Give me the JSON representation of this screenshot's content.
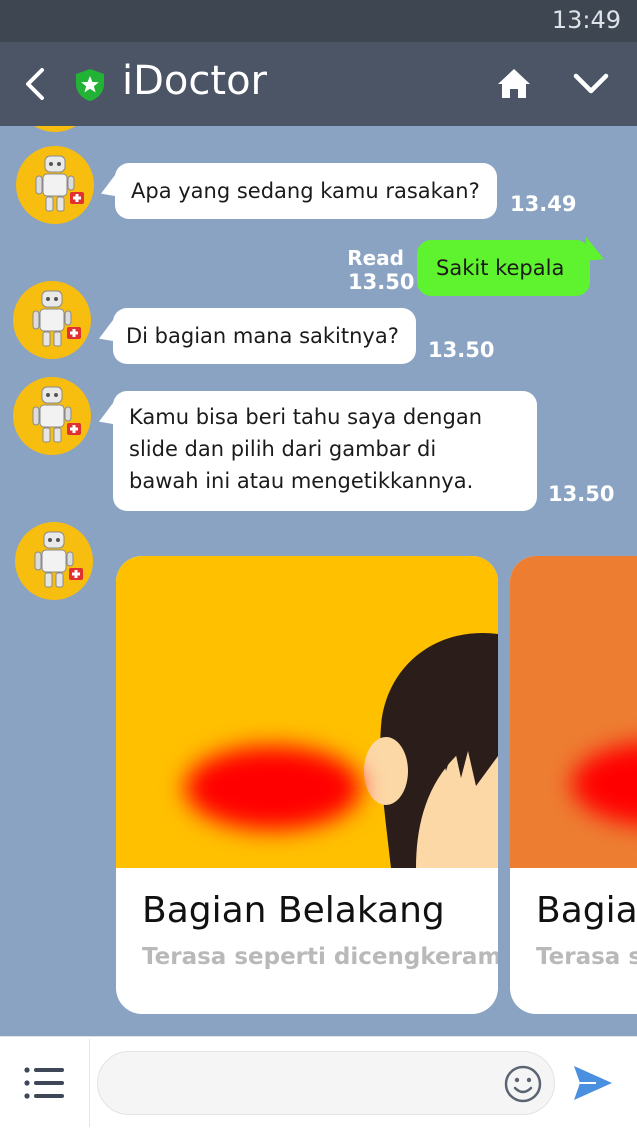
{
  "status_bar": {
    "time": "13:49"
  },
  "header": {
    "title": "iDoctor",
    "back_icon": "chevron-left-icon",
    "home_icon": "home-icon",
    "menu_icon": "chevron-down-icon",
    "colors": {
      "bar": "#4b5566",
      "shield": "#22b336"
    }
  },
  "chat": {
    "background": "#8aa3c3",
    "messages": [
      {
        "sender": "bot",
        "text": "Apa yang sedang kamu rasakan?",
        "time": "13.49"
      },
      {
        "sender": "user",
        "text": "Sakit kepala",
        "time": "13.50",
        "status": "Read"
      },
      {
        "sender": "bot",
        "text": "Di bagian mana sakitnya?",
        "time": "13.50"
      },
      {
        "sender": "bot",
        "lines": [
          "Kamu bisa beri tahu saya dengan",
          "slide dan pilih dari gambar di",
          "bawah ini atau mengetikkannya."
        ],
        "time": "13.50"
      }
    ],
    "carousel": [
      {
        "title": "Bagian Belakang",
        "subtitle": "Terasa seperti dicengkeram",
        "color": "#ffc000"
      },
      {
        "title": "Bagian",
        "subtitle": "Terasa se",
        "color": "#ed7d31"
      }
    ]
  },
  "input_bar": {
    "placeholder": "",
    "menu_icon": "list-icon",
    "emoji_icon": "smiley-icon",
    "send_icon": "send-icon",
    "send_color": "#4a8fe0"
  }
}
